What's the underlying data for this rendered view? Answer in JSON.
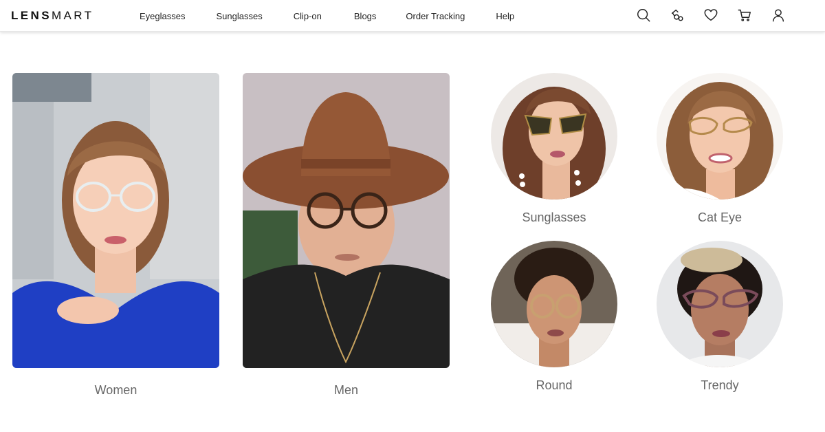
{
  "brand": {
    "logo_bold": "LENS",
    "logo_light": "MART"
  },
  "nav": {
    "items": [
      {
        "label": "Eyeglasses"
      },
      {
        "label": "Sunglasses"
      },
      {
        "label": "Clip-on"
      },
      {
        "label": "Blogs"
      },
      {
        "label": "Order Tracking"
      },
      {
        "label": "Help"
      }
    ]
  },
  "header_icons": [
    "search-icon",
    "try-on-icon",
    "heart-icon",
    "cart-icon",
    "user-icon"
  ],
  "categories": {
    "large": [
      {
        "label": "Women",
        "image": "woman-in-clear-frame-glasses-photo"
      },
      {
        "label": "Men",
        "image": "man-in-hat-round-glasses-photo"
      }
    ],
    "round": [
      {
        "label": "Sunglasses",
        "image": "woman-in-cat-sunglasses-photo"
      },
      {
        "label": "Cat Eye",
        "image": "woman-in-cat-eye-glasses-photo"
      },
      {
        "label": "Round",
        "image": "woman-in-tortoise-round-glasses-photo"
      },
      {
        "label": "Trendy",
        "image": "woman-in-sparkle-cat-eye-glasses-photo"
      }
    ]
  },
  "colors": {
    "label_text": "#666666",
    "header_text": "#222222"
  }
}
